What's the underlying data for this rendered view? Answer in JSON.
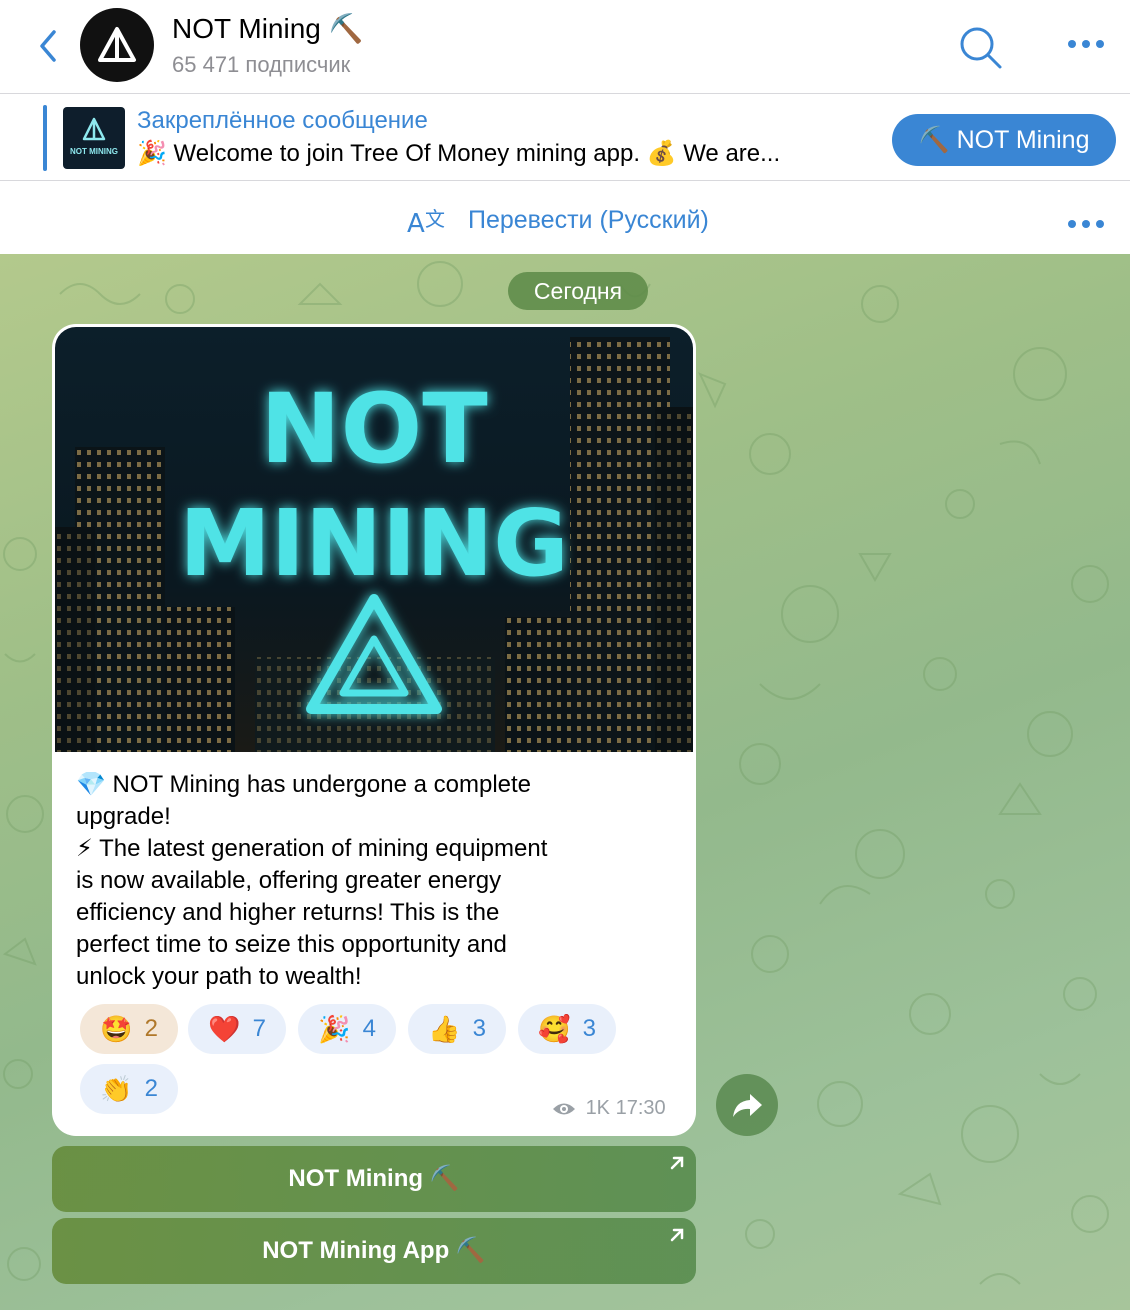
{
  "header": {
    "title": "NOT Mining ⛏️",
    "subtitle": "65 471 подписчик"
  },
  "pinned": {
    "label": "Закреплённое сообщение",
    "text": "🎉 Welcome to join Tree Of Money mining app.  💰 We are...",
    "thumb_text": "NOT MINING",
    "button_label": "⛏️ NOT Mining"
  },
  "translate": {
    "label": "Перевести (Русский)"
  },
  "chat": {
    "date_label": "Сегодня",
    "post": {
      "image_text_line1": "NOT",
      "image_text_line2": "MINING",
      "text_line1": "💎 NOT Mining has undergone a complete",
      "text_line2": "upgrade!",
      "text_line3": "⚡ The latest generation of mining equipment",
      "text_line4": "is now available, offering greater energy",
      "text_line5": "efficiency and higher returns! This is the",
      "text_line6": "perfect time to seize this opportunity and",
      "text_line7": "unlock your path to wealth!",
      "reactions": [
        {
          "emoji": "🤩",
          "count": "2"
        },
        {
          "emoji": "❤️",
          "count": "7"
        },
        {
          "emoji": "🎉",
          "count": "4"
        },
        {
          "emoji": "👍",
          "count": "3"
        },
        {
          "emoji": "🥰",
          "count": "3"
        },
        {
          "emoji": "👏",
          "count": "2"
        }
      ],
      "views": "1K",
      "time": "17:30"
    },
    "buttons": [
      {
        "label": "NOT Mining ⛏️"
      },
      {
        "label": "NOT Mining App ⛏️"
      }
    ]
  },
  "colors": {
    "accent": "#3a86d4",
    "chat_bg": "#a3c28f",
    "date_pill": "#5c8a46",
    "reaction_bg": "#e9f0fb"
  }
}
